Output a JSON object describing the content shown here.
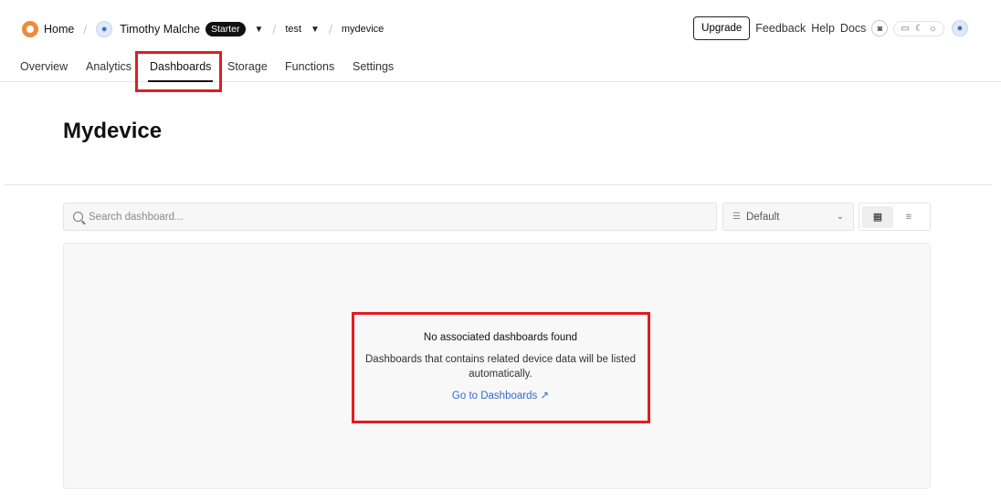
{
  "breadcrumb": {
    "home": "Home",
    "user": "Timothy Malche",
    "plan_badge": "Starter",
    "project": "test",
    "device": "mydevice"
  },
  "header_right": {
    "upgrade": "Upgrade",
    "feedback": "Feedback",
    "help": "Help",
    "docs": "Docs"
  },
  "tabs": [
    {
      "label": "Overview"
    },
    {
      "label": "Analytics"
    },
    {
      "label": "Dashboards"
    },
    {
      "label": "Storage"
    },
    {
      "label": "Functions"
    },
    {
      "label": "Settings"
    }
  ],
  "active_tab": "Dashboards",
  "page_title": "Mydevice",
  "search": {
    "placeholder": "Search dashboard..."
  },
  "sort": {
    "value": "Default"
  },
  "view_modes": [
    "grid",
    "list"
  ],
  "active_view": "grid",
  "empty_state": {
    "title": "No associated dashboards found",
    "description": "Dashboards that contains related device data will be listed automatically.",
    "link": "Go to Dashboards"
  },
  "colors": {
    "accent_link": "#2f6bd2",
    "highlight_box": "#e31b23",
    "logo": "#f08a3a"
  }
}
